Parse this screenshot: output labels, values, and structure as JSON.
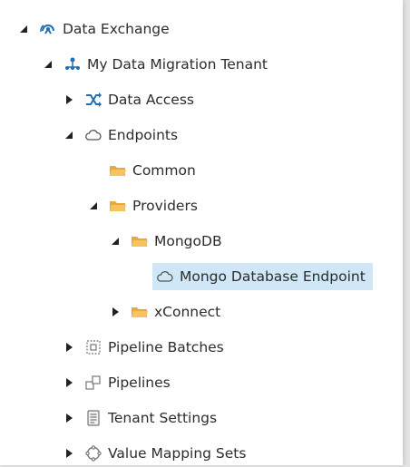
{
  "tree": {
    "items": [
      {
        "label": "Data Exchange",
        "icon": "data-exchange-icon",
        "state": "expanded"
      },
      {
        "label": "My Data Migration Tenant",
        "icon": "tenant-icon",
        "state": "expanded"
      },
      {
        "label": "Data Access",
        "icon": "shuffle-icon",
        "state": "collapsed"
      },
      {
        "label": "Endpoints",
        "icon": "cloud-icon",
        "state": "expanded"
      },
      {
        "label": "Common",
        "icon": "folder-icon",
        "state": "leaf"
      },
      {
        "label": "Providers",
        "icon": "folder-icon",
        "state": "expanded"
      },
      {
        "label": "MongoDB",
        "icon": "folder-icon",
        "state": "expanded"
      },
      {
        "label": "Mongo Database Endpoint",
        "icon": "cloud-icon",
        "state": "leaf",
        "selected": true
      },
      {
        "label": "xConnect",
        "icon": "folder-icon",
        "state": "collapsed"
      },
      {
        "label": "Pipeline Batches",
        "icon": "pipeline-batches-icon",
        "state": "collapsed"
      },
      {
        "label": "Pipelines",
        "icon": "pipelines-icon",
        "state": "collapsed"
      },
      {
        "label": "Tenant Settings",
        "icon": "settings-icon",
        "state": "collapsed"
      },
      {
        "label": "Value Mapping Sets",
        "icon": "value-mapping-icon",
        "state": "collapsed"
      }
    ]
  },
  "colors": {
    "selection": "#cfe7f6",
    "folder": "#f2b84b",
    "accent_blue": "#1f6fb5"
  }
}
